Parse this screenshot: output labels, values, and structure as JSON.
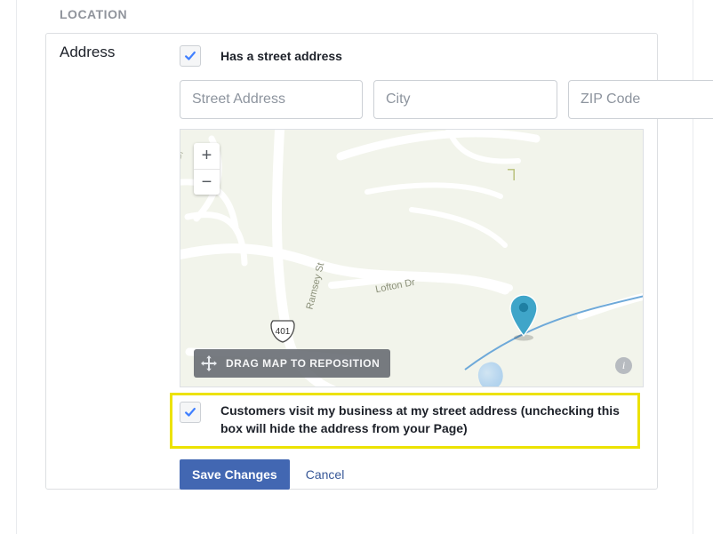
{
  "section_heading": "LOCATION",
  "label_address": "Address",
  "has_street_checkbox": {
    "checked": true,
    "label": "Has a street address"
  },
  "inputs": {
    "street": {
      "value": "",
      "placeholder": "Street Address"
    },
    "city": {
      "value": "",
      "placeholder": "City"
    },
    "zip": {
      "value": "",
      "placeholder": "ZIP Code"
    }
  },
  "map": {
    "drag_hint": "DRAG MAP TO REPOSITION",
    "route_shield": "401",
    "road_labels": {
      "ramsey": "Ramsey St",
      "lofton": "Lofton Dr",
      "faint": "Dr"
    },
    "zoom_in_glyph": "+",
    "zoom_out_glyph": "−",
    "info_glyph": "i"
  },
  "customers_visit_checkbox": {
    "checked": true,
    "label": "Customers visit my business at my street address (unchecking this box will hide the address from your Page)"
  },
  "actions": {
    "save": "Save Changes",
    "cancel": "Cancel"
  },
  "colors": {
    "primary": "#4267b2",
    "link": "#385898",
    "highlight_border": "#ece200",
    "checkbox_check": "#4080ff"
  }
}
